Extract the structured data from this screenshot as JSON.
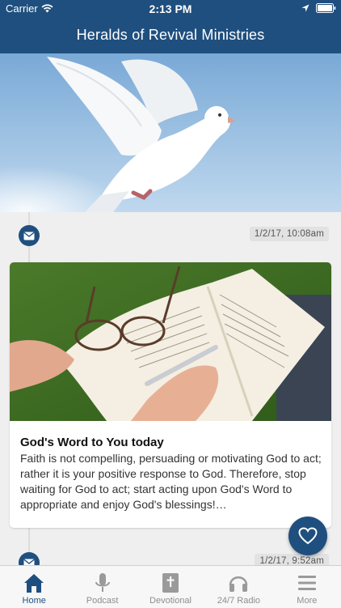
{
  "status_bar": {
    "carrier": "Carrier",
    "time": "2:13 PM"
  },
  "header": {
    "title": "Heralds of Revival Ministries"
  },
  "hero": {
    "icon": "dove-photo"
  },
  "feed": {
    "items": [
      {
        "type_icon": "envelope-icon",
        "date": "1/2/17, 10:08am",
        "image": "bible-reading-photo",
        "title": "God's Word to You today",
        "body": "Faith is not compelling, persuading or motivating God to act; rather it is your positive response to God. Therefore, stop waiting for God to act; start acting upon God's Word to appropriate and enjoy God's blessings!…"
      },
      {
        "type_icon": "envelope-icon",
        "date": "1/2/17, 9:52am"
      }
    ]
  },
  "fab": {
    "icon": "heart-icon"
  },
  "tabs": [
    {
      "label": "Home",
      "icon": "home-icon",
      "active": true
    },
    {
      "label": "Podcast",
      "icon": "microphone-icon",
      "active": false
    },
    {
      "label": "Devotional",
      "icon": "bible-icon",
      "active": false
    },
    {
      "label": "24/7 Radio",
      "icon": "headphones-icon",
      "active": false
    },
    {
      "label": "More",
      "icon": "menu-icon",
      "active": false
    }
  ],
  "colors": {
    "brand": "#1f4f7e",
    "tab_inactive": "#8e8e8e",
    "background": "#efefef"
  }
}
